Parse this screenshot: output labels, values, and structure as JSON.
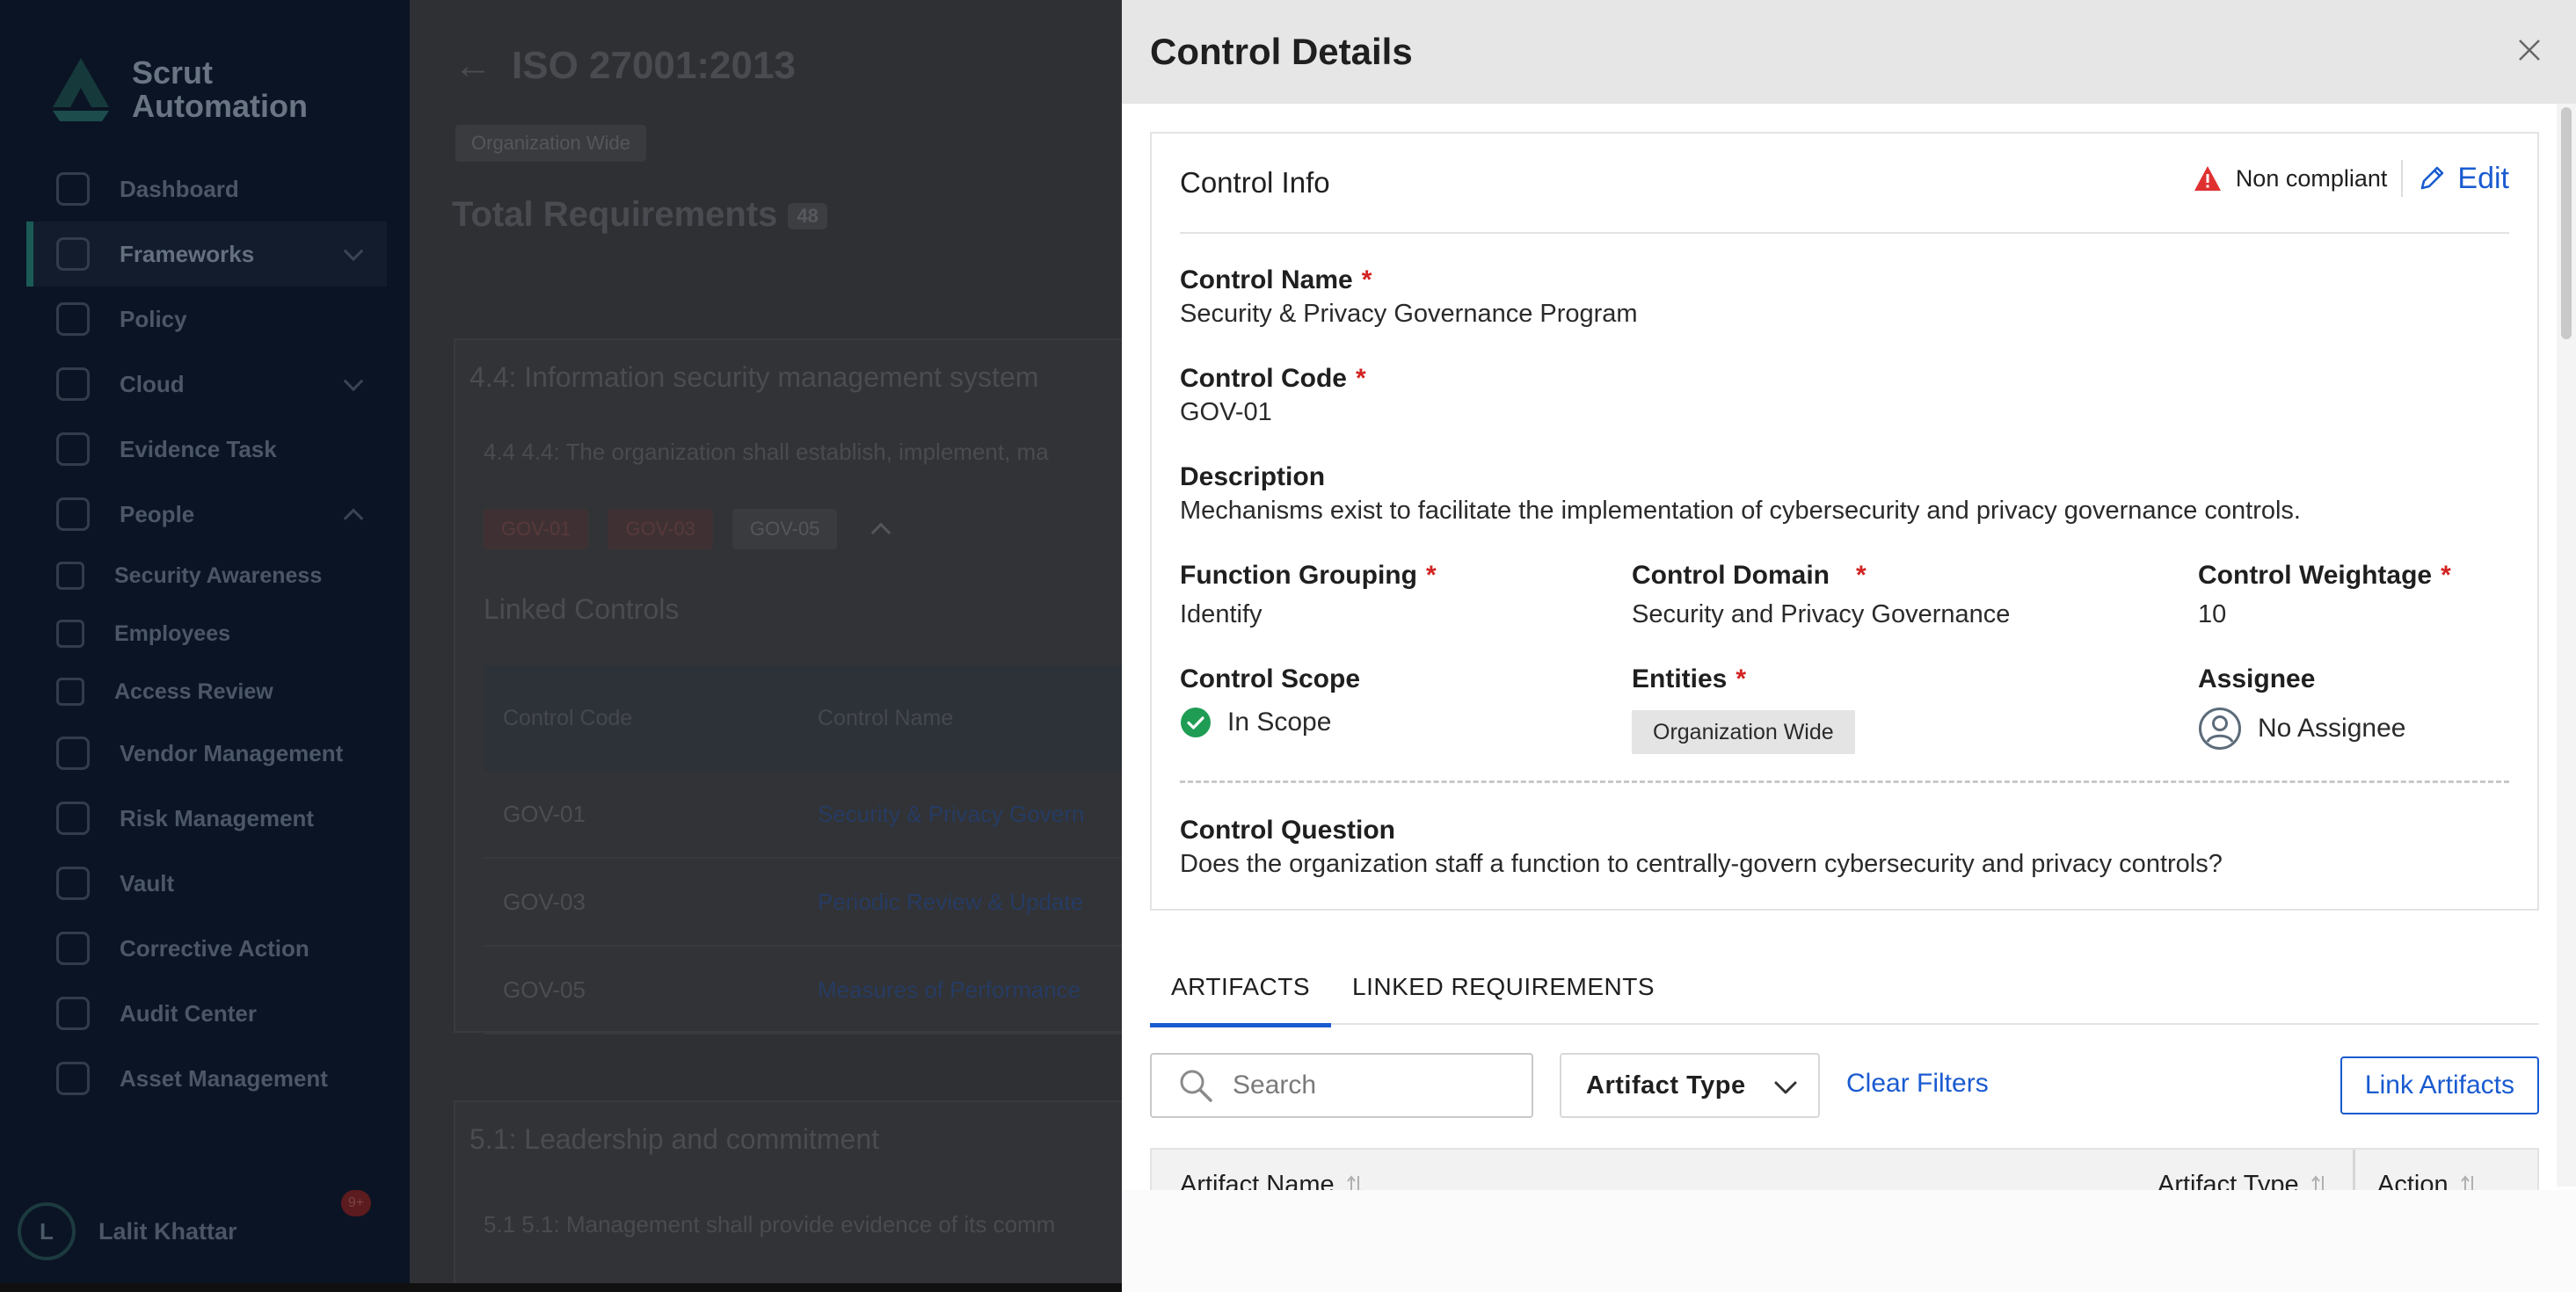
{
  "background": {
    "logo": {
      "line1": "Scrut",
      "line2": "Automation"
    },
    "nav": [
      {
        "label": "Dashboard",
        "icon": "dashboard-icon"
      },
      {
        "label": "Frameworks",
        "icon": "frameworks-icon",
        "active": true,
        "caret": "down"
      },
      {
        "label": "Policy",
        "icon": "policy-icon"
      },
      {
        "label": "Cloud",
        "icon": "cloud-icon",
        "caret": "down"
      },
      {
        "label": "Evidence Task",
        "icon": "evidence-icon"
      },
      {
        "label": "People",
        "icon": "people-icon",
        "caret": "up"
      },
      {
        "label": "Security Awareness",
        "icon": "security-awareness-icon",
        "sub": true
      },
      {
        "label": "Employees",
        "icon": "employees-icon",
        "sub": true
      },
      {
        "label": "Access Review",
        "icon": "access-review-icon",
        "sub": true
      },
      {
        "label": "Vendor Management",
        "icon": "vendor-icon"
      },
      {
        "label": "Risk Management",
        "icon": "risk-icon"
      },
      {
        "label": "Vault",
        "icon": "vault-icon"
      },
      {
        "label": "Corrective Action",
        "icon": "corrective-icon"
      },
      {
        "label": "Audit Center",
        "icon": "audit-icon"
      },
      {
        "label": "Asset Management",
        "icon": "asset-icon"
      }
    ],
    "user": {
      "initial": "L",
      "name": "Lalit Khattar",
      "badge": "9+"
    },
    "page": {
      "title": "ISO 27001:2013",
      "chip": "Organization Wide",
      "total_label": "Total Requirements",
      "total_count": "48",
      "section1_title": "4.4: Information security management system",
      "section1_req": "4.4 4.4: The organization shall establish, implement, ma",
      "tags": [
        "GOV-01",
        "GOV-03",
        "GOV-05"
      ],
      "linked_title": "Linked Controls",
      "table_headers": [
        "Control Code",
        "Control Name"
      ],
      "rows": [
        {
          "code": "GOV-01",
          "name": "Security & Privacy Govern"
        },
        {
          "code": "GOV-03",
          "name": "Periodic Review & Update"
        },
        {
          "code": "GOV-05",
          "name": "Measures of Performance"
        }
      ],
      "section2_title": "5.1: Leadership and commitment",
      "section2_req": "5.1 5.1: Management shall provide evidence of its comm"
    }
  },
  "drawer": {
    "title": "Control Details",
    "info": {
      "title": "Control Info",
      "status": "Non compliant",
      "edit_label": "Edit",
      "control_name_label": "Control Name",
      "control_name": "Security & Privacy Governance Program",
      "control_code_label": "Control Code",
      "control_code": "GOV-01",
      "description_label": "Description",
      "description": "Mechanisms exist to facilitate the implementation of cybersecurity and privacy governance controls.",
      "function_grouping_label": "Function Grouping",
      "function_grouping": "Identify",
      "control_domain_label": "Control Domain",
      "control_domain": "Security and Privacy Governance",
      "control_weightage_label": "Control Weightage",
      "control_weightage": "10",
      "control_scope_label": "Control Scope",
      "control_scope": "In Scope",
      "entities_label": "Entities",
      "entity": "Organization Wide",
      "assignee_label": "Assignee",
      "assignee": "No Assignee",
      "question_label": "Control Question",
      "question": "Does the organization staff a function to centrally-govern cybersecurity and privacy controls?",
      "required_mark": "*"
    },
    "tabs": [
      "ARTIFACTS",
      "LINKED REQUIREMENTS"
    ],
    "filters": {
      "search_placeholder": "Search",
      "artifact_type": "Artifact Type",
      "clear": "Clear Filters",
      "link_button": "Link Artifacts"
    },
    "table_headers": {
      "name": "Artifact Name",
      "type": "Artifact Type",
      "action": "Action"
    }
  },
  "colors": {
    "accent": "#1a5bd0",
    "required": "#d32222",
    "warning": "#e03131",
    "success": "#1f9d55",
    "overlay": "#2f3033"
  }
}
